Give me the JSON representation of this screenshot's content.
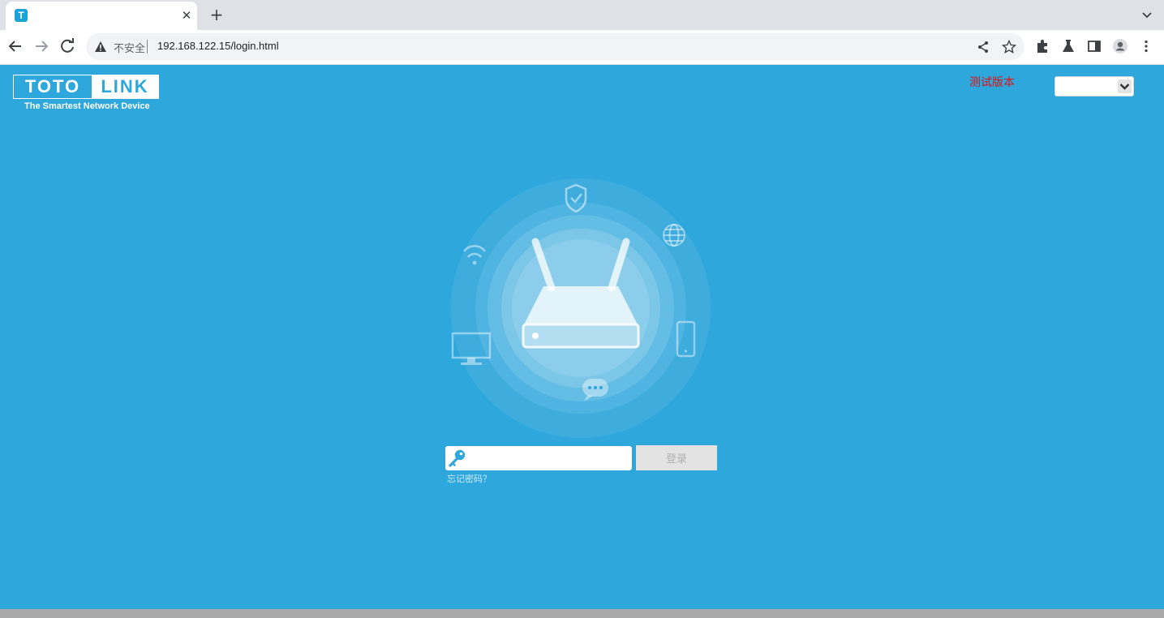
{
  "browser": {
    "tab": {
      "title": "",
      "favicon_letter": "T"
    },
    "omnibox": {
      "security_label": "不安全",
      "url": "192.168.122.15/login.html"
    }
  },
  "header": {
    "logo": {
      "left": "TOTO",
      "right": "LINK",
      "tagline": "The Smartest Network Device"
    },
    "test_version": "测试版本",
    "language_select": {
      "value": ""
    }
  },
  "login": {
    "password_placeholder": "",
    "submit_label": "登录",
    "forgot_password": "忘记密码？"
  },
  "colors": {
    "page_bg": "#2ea7dc",
    "test_version": "#e01010",
    "button_bg": "#e3e3e3"
  }
}
